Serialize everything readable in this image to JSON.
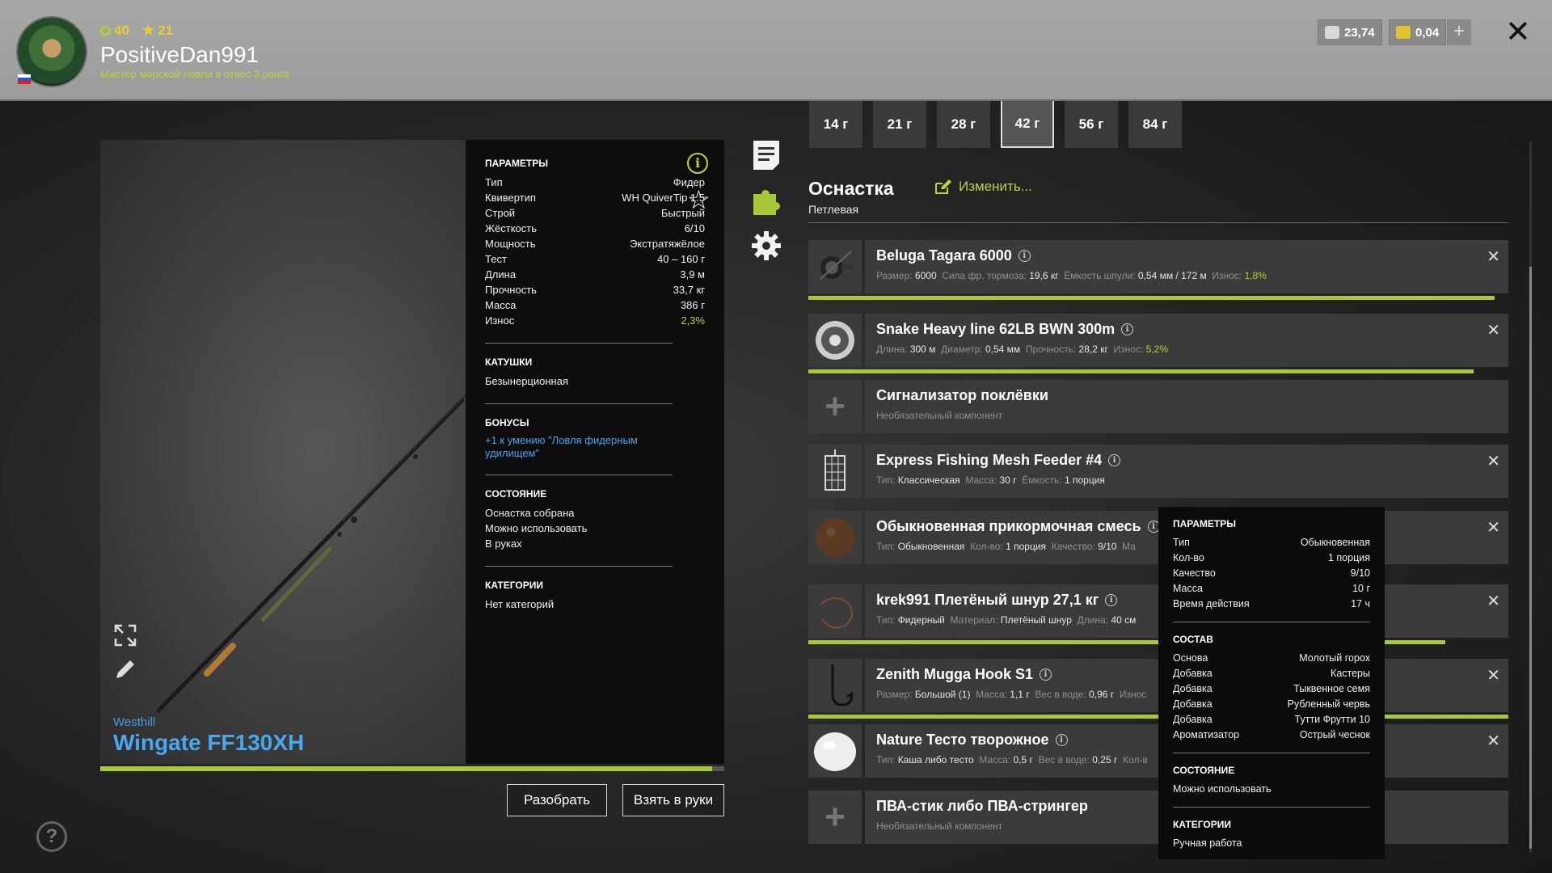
{
  "header": {
    "level": "40",
    "stars": "21",
    "username": "PositiveDan991",
    "rank": "Мастер морской ловли в отвес 3 ранга",
    "silver": "23,74",
    "gold": "0,04",
    "plus": "+",
    "close": "✕"
  },
  "rod": {
    "brand": "Westhill",
    "name": "Wingate FF130XH",
    "progress": 0.98,
    "params_title": "ПАРАМЕТРЫ",
    "params": [
      {
        "k": "Тип",
        "v": "Фидер"
      },
      {
        "k": "Квивертип",
        "v": "WH QuiverTip 1.5"
      },
      {
        "k": "Строй",
        "v": "Быстрый"
      },
      {
        "k": "Жёсткость",
        "v": "6/10"
      },
      {
        "k": "Мощность",
        "v": "Экстратяжёлое"
      },
      {
        "k": "Тест",
        "v": "40 – 160 г"
      },
      {
        "k": "Длина",
        "v": "3,9 м"
      },
      {
        "k": "Прочность",
        "v": "33,7 кг"
      },
      {
        "k": "Масса",
        "v": "386 г"
      },
      {
        "k": "Износ",
        "v": "2,3%"
      }
    ],
    "reels_title": "КАТУШКИ",
    "reels": "Безынерционная",
    "bonus_title": "БОНУСЫ",
    "bonus": "+1 к умению \"Ловля фидерным удилищем\"",
    "state_title": "СОСТОЯНИЕ",
    "states": [
      "Оснастка собрана",
      "Можно использовать",
      "В руках"
    ],
    "cat_title": "КАТЕГОРИИ",
    "categories": "Нет категорий",
    "info": "i",
    "star": "☆"
  },
  "buttons": {
    "disassemble": "Разобрать",
    "take": "Взять в руки",
    "help": "?"
  },
  "weights": [
    "14 г",
    "21 г",
    "28 г",
    "42 г",
    "56 г",
    "84 г"
  ],
  "weight_active": "42 г",
  "rig": {
    "title": "Оснастка",
    "subtitle": "Петлевая",
    "change": "Изменить..."
  },
  "components": [
    {
      "name": "Beluga Tagara 6000",
      "info": "i",
      "props": [
        [
          "Размер:",
          "6000"
        ],
        [
          "Сила фр. тормоза:",
          "19,6 кг"
        ],
        [
          "Ёмкость шпули:",
          "0,54 мм / 172 м"
        ],
        [
          "Износ:",
          "1,8%"
        ]
      ],
      "wear": 0.98,
      "icon": "reel-icon"
    },
    {
      "name": "Snake Heavy line 62LB BWN 300m",
      "info": "i",
      "props": [
        [
          "Длина:",
          "300 м"
        ],
        [
          "Диаметр:",
          "0,54 мм"
        ],
        [
          "Прочность:",
          "28,2 кг"
        ],
        [
          "Износ:",
          "5,2%"
        ]
      ],
      "wear": 0.95,
      "icon": "line-spool-icon"
    },
    {
      "name": "Сигнализатор поклёвки",
      "info": "",
      "optional": "Необязательный компонент",
      "icon": "plus-icon"
    },
    {
      "name": "Express Fishing Mesh Feeder #4",
      "info": "i",
      "props": [
        [
          "Тип:",
          "Классическая"
        ],
        [
          "Масса:",
          "30 г"
        ],
        [
          "Ёмкость:",
          "1 порция"
        ]
      ],
      "icon": "feeder-icon"
    },
    {
      "name": "Обыкновенная прикормочная смесь",
      "info": "i",
      "props": [
        [
          "Тип:",
          "Обыкновенная"
        ],
        [
          "Кол-во:",
          "1 порция"
        ],
        [
          "Качество:",
          "9/10"
        ],
        [
          "Ма",
          ""
        ]
      ],
      "icon": "groundbait-icon"
    },
    {
      "name": "krek991 Плетёный шнур 27,1 кг",
      "info": "i",
      "props": [
        [
          "Тип:",
          "Фидерный"
        ],
        [
          "Материал:",
          "Плетёный шнур"
        ],
        [
          "Длина:",
          "40 см"
        ]
      ],
      "wear": 0.91,
      "icon": "leader-icon"
    },
    {
      "name": "Zenith Mugga Hook S1",
      "info": "i",
      "props": [
        [
          "Размер:",
          "Большой (1)"
        ],
        [
          "Масса:",
          "1,1 г"
        ],
        [
          "Вес в воде:",
          "0,96 г"
        ],
        [
          "Износ",
          ""
        ]
      ],
      "wear": 1.0,
      "icon": "hook-icon"
    },
    {
      "name": "Nature Тесто творожное",
      "info": "i",
      "props": [
        [
          "Тип:",
          "Каша либо тесто"
        ],
        [
          "Масса:",
          "0,5 г"
        ],
        [
          "Вес в воде:",
          "0,25 г"
        ],
        [
          "Кол-в",
          ""
        ]
      ],
      "icon": "dough-icon"
    },
    {
      "name": "ПВА-стик либо ПВА-стрингер",
      "info": "",
      "optional": "Необязательный компонент",
      "icon": "plus-icon"
    }
  ],
  "tooltip": {
    "params_title": "ПАРАМЕТРЫ",
    "params": [
      {
        "k": "Тип",
        "v": "Обыкновенная"
      },
      {
        "k": "Кол-во",
        "v": "1 порция"
      },
      {
        "k": "Качество",
        "v": "9/10"
      },
      {
        "k": "Масса",
        "v": "10 г"
      },
      {
        "k": "Время действия",
        "v": "17 ч"
      }
    ],
    "comp_title": "СОСТАВ",
    "composition": [
      {
        "k": "Основа",
        "v": "Молотый горох"
      },
      {
        "k": "Добавка",
        "v": "Кастеры"
      },
      {
        "k": "Добавка",
        "v": "Тыквенное семя"
      },
      {
        "k": "Добавка",
        "v": "Рубленный червь"
      },
      {
        "k": "Добавка",
        "v": "Тутти Фрутти 10"
      },
      {
        "k": "Ароматизатор",
        "v": "Острый чеснок"
      }
    ],
    "state_title": "СОСТОЯНИЕ",
    "state": "Можно использовать",
    "cat_title": "КАТЕГОРИИ",
    "category": "Ручная работа"
  },
  "colors": {
    "accent": "#bcd23f",
    "link": "#4aa6ee",
    "progress": "#a7c83a"
  }
}
